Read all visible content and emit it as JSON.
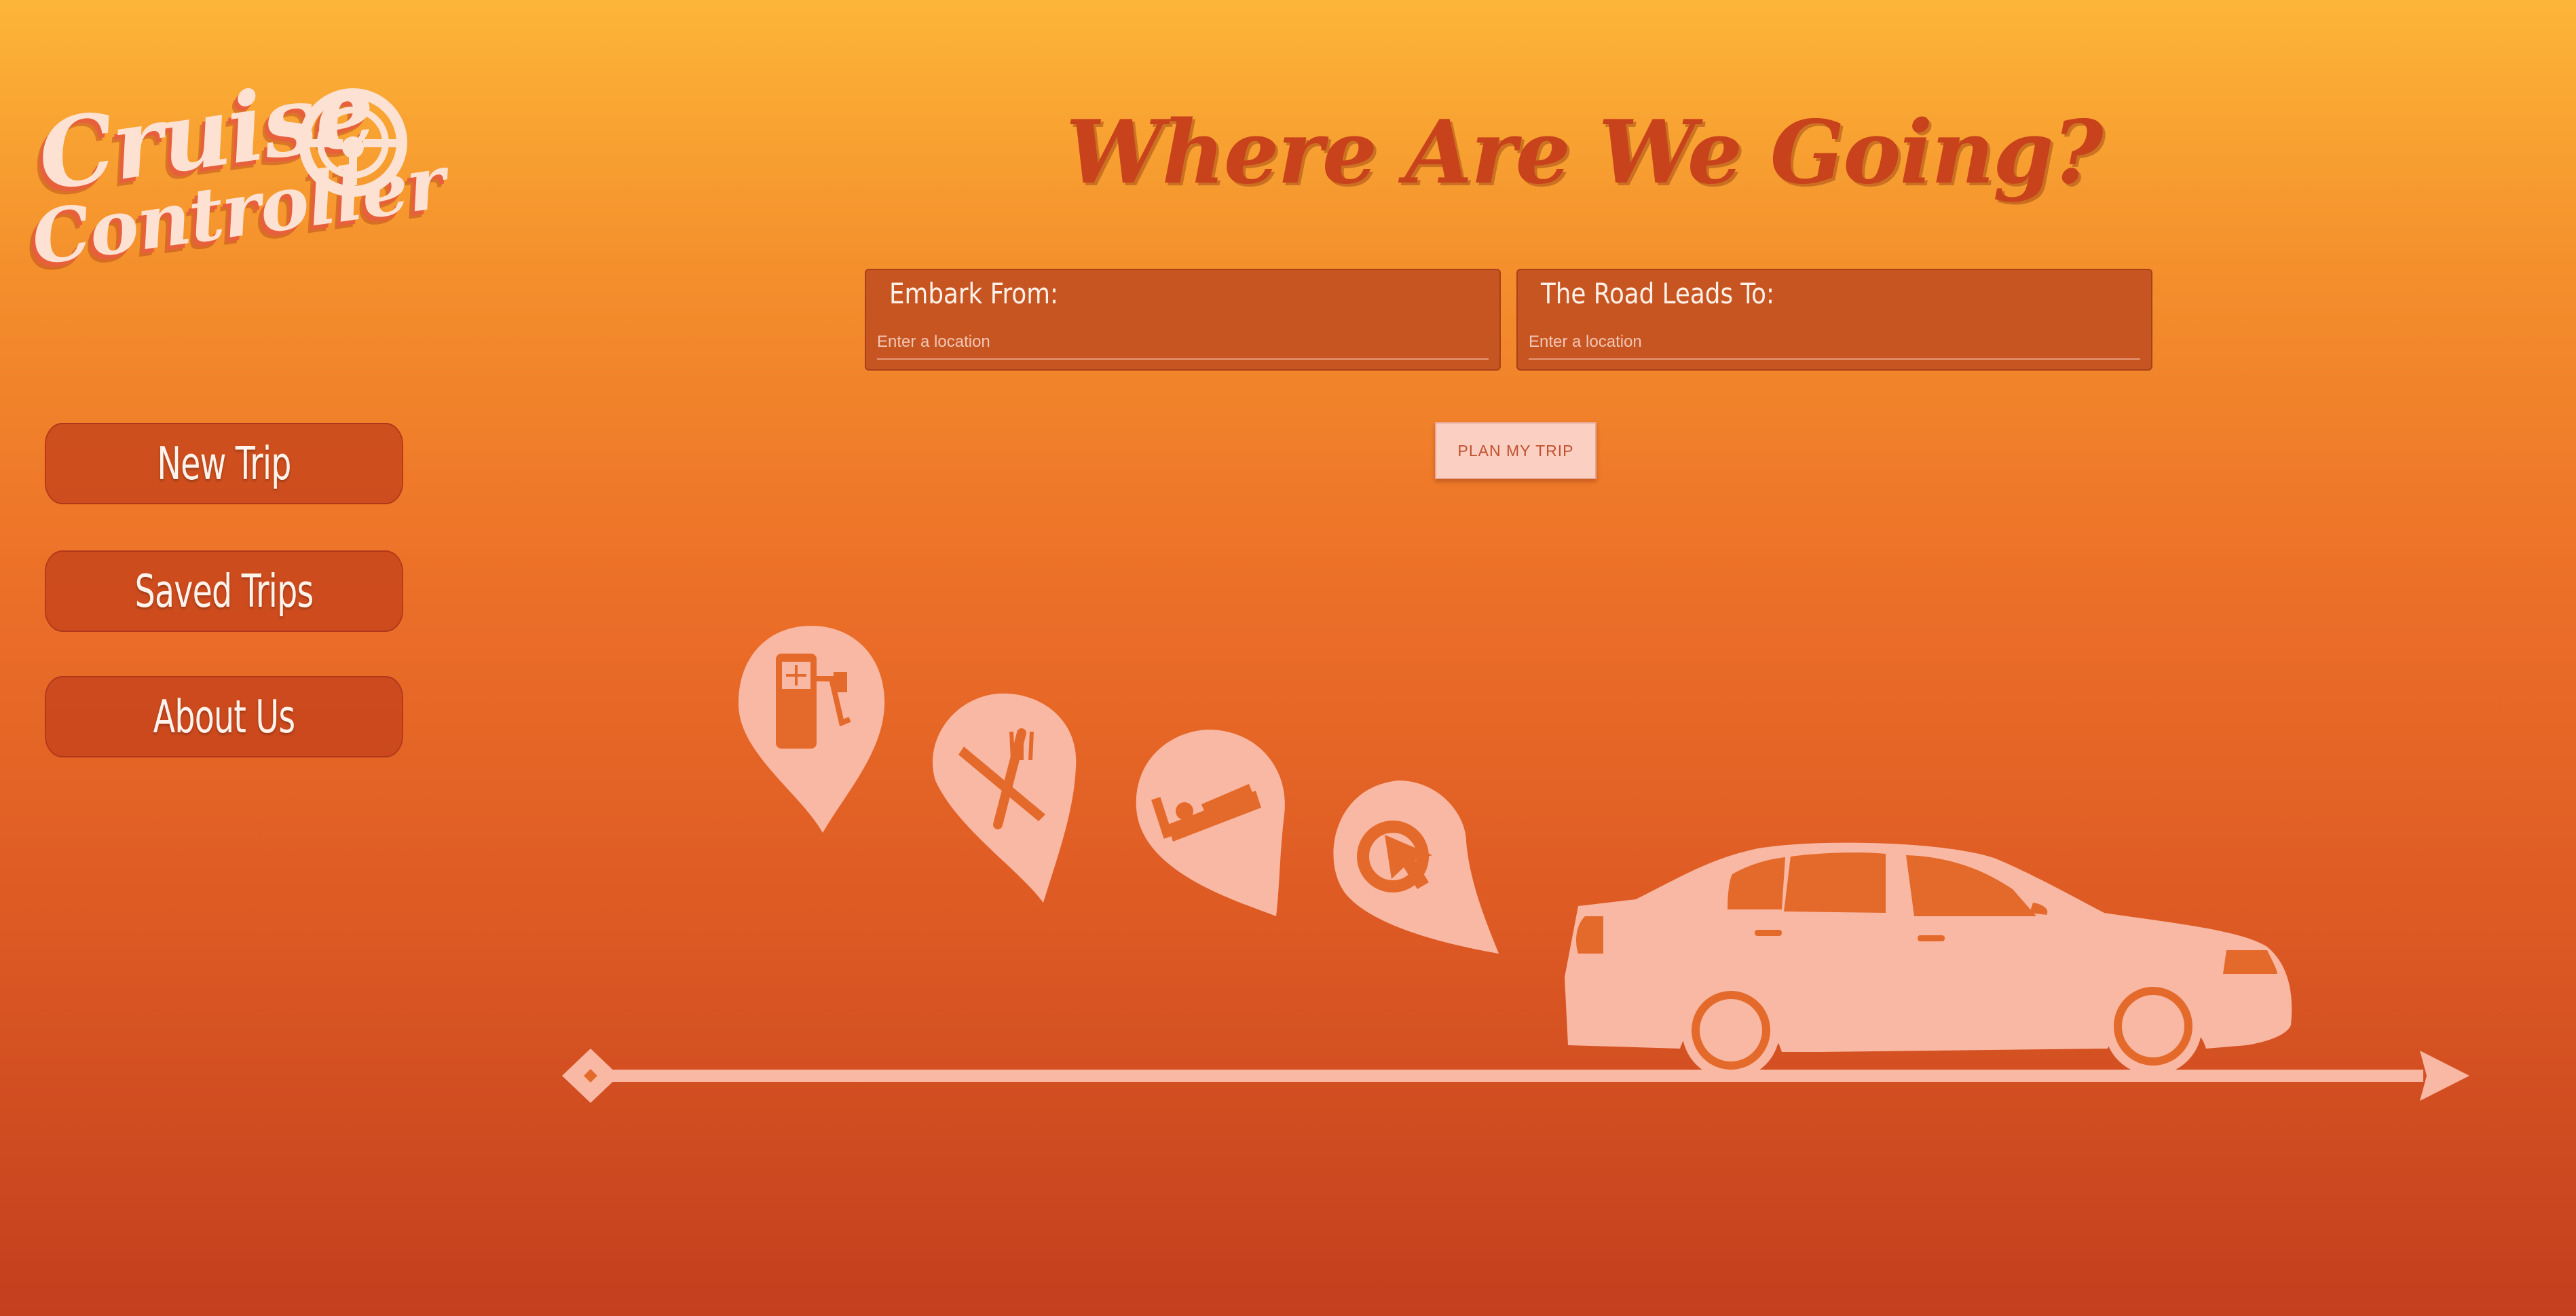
{
  "logo": {
    "line1": "Cruise",
    "line2": "Controller"
  },
  "nav": {
    "items": [
      {
        "label": "New Trip"
      },
      {
        "label": "Saved Trips"
      },
      {
        "label": "About Us"
      }
    ]
  },
  "main": {
    "title": "Where Are We Going?",
    "from": {
      "label": "Embark From:",
      "value": "",
      "placeholder": "Enter a location"
    },
    "to": {
      "label": "The Road Leads To:",
      "value": "",
      "placeholder": "Enter a location"
    },
    "plan_button": "PLAN MY TRIP"
  },
  "illustration": {
    "pins": [
      "gas-station-icon",
      "restaurant-icon",
      "hotel-icon",
      "detour-icon"
    ],
    "vehicle": "car-icon",
    "road": "road-timeline"
  },
  "colors": {
    "gradient_top": "#fdb538",
    "gradient_bottom": "#c33f1e",
    "accent": "#c8421b",
    "illustration": "#f9b8a3",
    "button_fill": "#fbd0c3"
  }
}
